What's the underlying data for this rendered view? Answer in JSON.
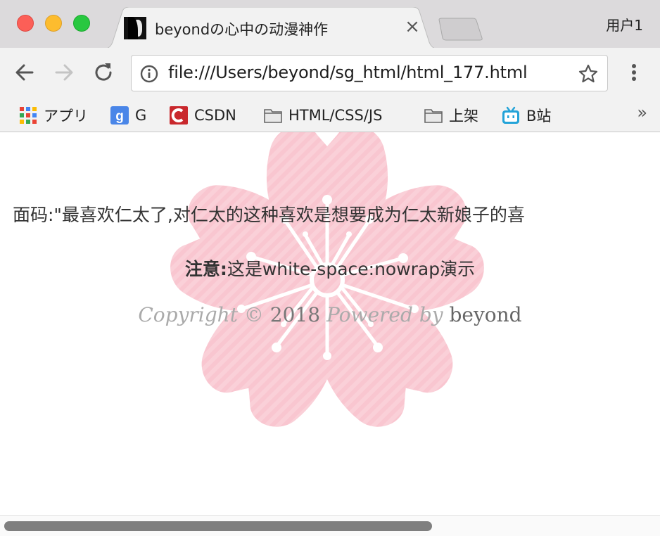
{
  "window": {
    "profile": "用户1"
  },
  "tab": {
    "title": "beyondの心中の动漫神作",
    "close": "×"
  },
  "omnibox": {
    "url": "file:///Users/beyond/sg_html/html_177.html"
  },
  "bookmarks": {
    "items": [
      {
        "label": "アプリ",
        "icon": "apps-grid-icon"
      },
      {
        "label": "G",
        "icon": "google-search-icon"
      },
      {
        "label": "CSDN",
        "icon": "csdn-icon"
      },
      {
        "label": "HTML/CSS/JS",
        "icon": "folder-icon"
      },
      {
        "label": "上架",
        "icon": "folder-icon"
      },
      {
        "label": "B站",
        "icon": "bilibili-icon"
      }
    ],
    "more": "»"
  },
  "page": {
    "quote": "面码:\"最喜欢仁太了,对仁太的这种喜欢是想要成为仁太新娘子的喜",
    "note_label": "注意:",
    "note_text": "这是white-space:nowrap演示",
    "copyright_prefix": "Copyright ©",
    "copyright_year": "2018",
    "powered_by": "Powered by",
    "author": "beyond"
  },
  "colors": {
    "blossom": "#f9c6d0",
    "titlebar": "#dcdadc",
    "toolbar": "#f2f2f2"
  }
}
